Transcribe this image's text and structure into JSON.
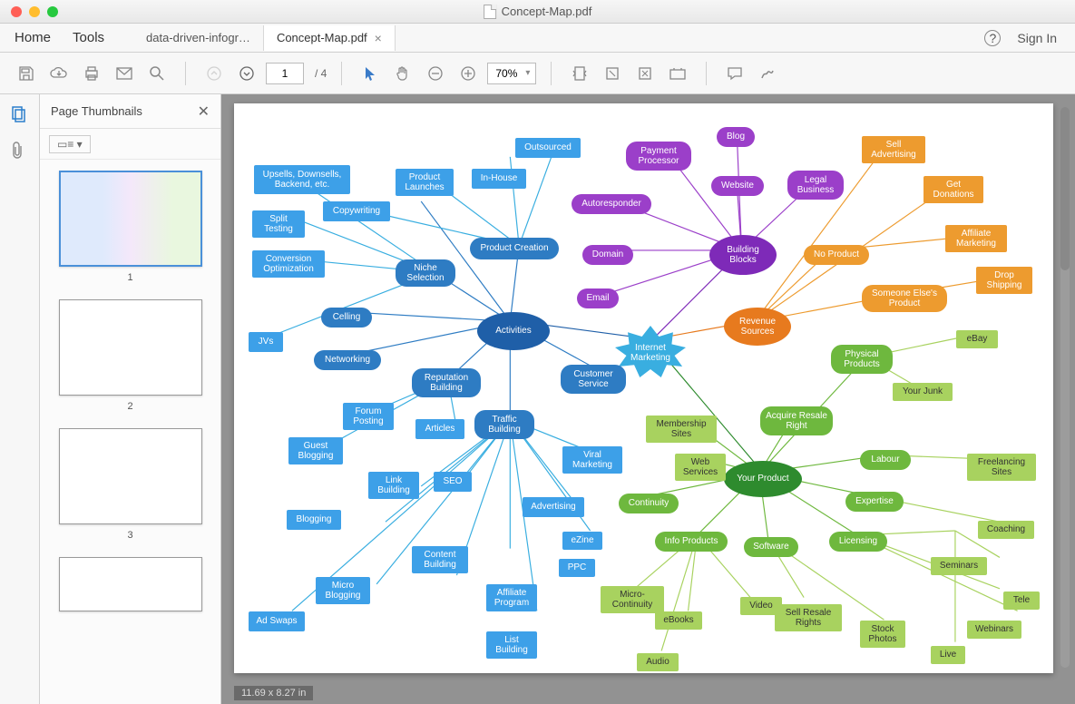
{
  "window": {
    "title": "Concept-Map.pdf"
  },
  "menu": {
    "home": "Home",
    "tools": "Tools"
  },
  "tabs": [
    {
      "label": "data-driven-infogr…",
      "active": false
    },
    {
      "label": "Concept-Map.pdf",
      "active": true
    }
  ],
  "signin": {
    "label": "Sign In"
  },
  "toolbar": {
    "page_current": "1",
    "page_total": "/ 4",
    "zoom": "70%"
  },
  "sidebar": {
    "title": "Page Thumbnails",
    "thumbs": [
      "1",
      "2",
      "3"
    ]
  },
  "status": {
    "dims": "11.69 x 8.27 in"
  },
  "nodes": {
    "activities": "Activities",
    "internet": "Internet Marketing",
    "building": "Building Blocks",
    "revenue": "Revenue Sources",
    "yourprod": "Your Product",
    "outsourced": "Outsourced",
    "inhouse": "In-House",
    "prodlaunch": "Product Launches",
    "copywriting": "Copywriting",
    "upsells": "Upsells, Downsells, Backend, etc.",
    "split": "Split Testing",
    "conv": "Conversion Optimization",
    "jvs": "JVs",
    "celling": "Celling",
    "networking": "Networking",
    "niche": "Niche Selection",
    "prodcreate": "Product Creation",
    "reputation": "Reputation Building",
    "forum": "Forum Posting",
    "articles": "Articles",
    "guest": "Guest Blogging",
    "link": "Link Building",
    "seo": "SEO",
    "blogging": "Blogging",
    "micro": "Micro Blogging",
    "adswaps": "Ad Swaps",
    "content": "Content Building",
    "affprog": "Affiliate Program",
    "list": "List Building",
    "traffic": "Traffic Building",
    "viral": "Viral Marketing",
    "advert": "Advertising",
    "ezine": "eZine",
    "ppc": "PPC",
    "customer": "Customer Service",
    "blog": "Blog",
    "payment": "Payment Processor",
    "website": "Website",
    "legal": "Legal Business",
    "autoresp": "Autoresponder",
    "domain": "Domain",
    "email": "Email",
    "sellad": "Sell Advertising",
    "getdon": "Get Donations",
    "noprod": "No Product",
    "affmkt": "Affiliate Marketing",
    "someone": "Someone Else's Product",
    "drop": "Drop Shipping",
    "ebay": "eBay",
    "physical": "Physical Products",
    "yourjunk": "Your Junk",
    "acquire": "Acquire Resale Right",
    "membership": "Membership Sites",
    "webserv": "Web Services",
    "labour": "Labour",
    "freelance": "Freelancing Sites",
    "continuity": "Continuity",
    "expertise": "Expertise",
    "coaching": "Coaching",
    "info": "Info Products",
    "software": "Software",
    "licensing": "Licensing",
    "seminars": "Seminars",
    "microcont": "Micro-Continuity",
    "video": "Video",
    "ebooks": "eBooks",
    "sellresale": "Sell Resale Rights",
    "tele": "Tele",
    "audio": "Audio",
    "stock": "Stock Photos",
    "webinars": "Webinars",
    "live": "Live"
  }
}
